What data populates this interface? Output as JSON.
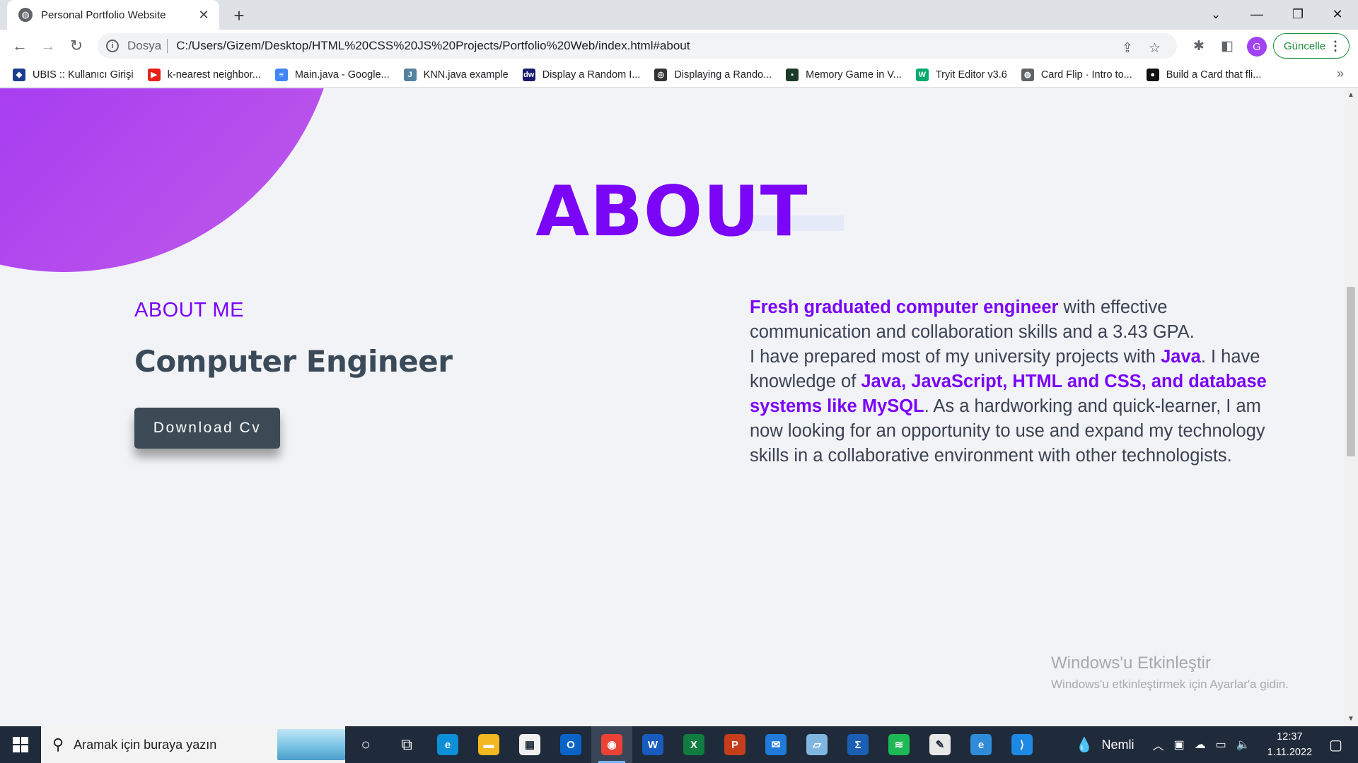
{
  "browser": {
    "tab_title": "Personal Portfolio Website",
    "tab_close": "✕",
    "new_tab": "+",
    "url_scheme": "Dosya",
    "url": "C:/Users/Gizem/Desktop/HTML%20CSS%20JS%20Projects/Portfolio%20Web/index.html#about",
    "profile_initial": "G",
    "update_label": "Güncelle",
    "bookmarks": [
      {
        "label": "UBIS :: Kullanıcı Girişi",
        "icon": "ubis-icon",
        "color": "#1a3d8f",
        "glyph": "◆"
      },
      {
        "label": "k-nearest neighbor...",
        "icon": "youtube-icon",
        "color": "#e62117",
        "glyph": "▶"
      },
      {
        "label": "Main.java - Google...",
        "icon": "google-docs-icon",
        "color": "#4285f4",
        "glyph": "≡"
      },
      {
        "label": "KNN.java example",
        "icon": "java-icon",
        "color": "#5382a1",
        "glyph": "J"
      },
      {
        "label": "Display a Random I...",
        "icon": "dw-icon",
        "color": "#1a1a6e",
        "glyph": "dw"
      },
      {
        "label": "Displaying a Rando...",
        "icon": "circle-icon",
        "color": "#333333",
        "glyph": "◎"
      },
      {
        "label": "Memory Game in V...",
        "icon": "memory-game-icon",
        "color": "#1b3a2a",
        "glyph": "▪"
      },
      {
        "label": "Tryit Editor v3.6",
        "icon": "w3schools-icon",
        "color": "#04aa6d",
        "glyph": "W"
      },
      {
        "label": "Card Flip · Intro to...",
        "icon": "globe-icon",
        "color": "#5f6368",
        "glyph": "◍"
      },
      {
        "label": "Build a Card that fli...",
        "icon": "medium-icon",
        "color": "#111111",
        "glyph": "●"
      }
    ]
  },
  "page": {
    "heading": "ABOUT",
    "about_me_label": "ABOUT ME",
    "job_title": "Computer Engineer",
    "download_label": "Download Cv",
    "about_text": {
      "p1_hl": "Fresh graduated computer engineer",
      "p1_rest": " with effective communication and collaboration skills and a 3.43 GPA.",
      "p2_start": "I have prepared most of my university projects with ",
      "p2_hl1": "Java",
      "p2_mid": ". I have knowledge of ",
      "p2_hl2": "Java, JavaScript, HTML and CSS, and database systems like MySQL",
      "p2_end": ". As a hardworking and quick-learner, I am now looking for an opportunity to use and expand my technology skills in a collaborative environment with other technologists."
    },
    "accent_color": "#7a05f7",
    "dark_color": "#3b4a55"
  },
  "windows": {
    "activate_title": "Windows'u Etkinleştir",
    "activate_sub": "Windows'u etkinleştirmek için Ayarlar'a gidin.",
    "search_placeholder": "Aramak için buraya yazın",
    "weather": "Nemli",
    "time": "12:37",
    "date": "1.11.2022",
    "taskbar_apps": [
      {
        "name": "cortana-icon",
        "color": "transparent",
        "glyph": "○"
      },
      {
        "name": "task-view-icon",
        "color": "transparent",
        "glyph": "⧉"
      },
      {
        "name": "edge-icon",
        "color": "#0c8fd6",
        "glyph": "e"
      },
      {
        "name": "file-explorer-icon",
        "color": "#f3b81f",
        "glyph": "▬"
      },
      {
        "name": "ms-store-icon",
        "color": "#f0f0f0",
        "glyph": "▦"
      },
      {
        "name": "outlook-icon",
        "color": "#0a64c8",
        "glyph": "O"
      },
      {
        "name": "chrome-icon",
        "color": "#ea4335",
        "glyph": "◉"
      },
      {
        "name": "word-icon",
        "color": "#185abd",
        "glyph": "W"
      },
      {
        "name": "excel-icon",
        "color": "#107c41",
        "glyph": "X"
      },
      {
        "name": "powerpoint-icon",
        "color": "#c43e1c",
        "glyph": "P"
      },
      {
        "name": "mail-icon",
        "color": "#1f7ad9",
        "glyph": "✉"
      },
      {
        "name": "notes-app-icon",
        "color": "#7fb7e0",
        "glyph": "▱"
      },
      {
        "name": "sigma-app-icon",
        "color": "#1a5fb4",
        "glyph": "Σ"
      },
      {
        "name": "spotify-icon",
        "color": "#1db954",
        "glyph": "≋"
      },
      {
        "name": "paint-icon",
        "color": "#e8e8e8",
        "glyph": "✎"
      },
      {
        "name": "network-app-icon",
        "color": "#2f8cd8",
        "glyph": "e"
      },
      {
        "name": "vscode-icon",
        "color": "#1e88e5",
        "glyph": "⟩"
      }
    ]
  }
}
